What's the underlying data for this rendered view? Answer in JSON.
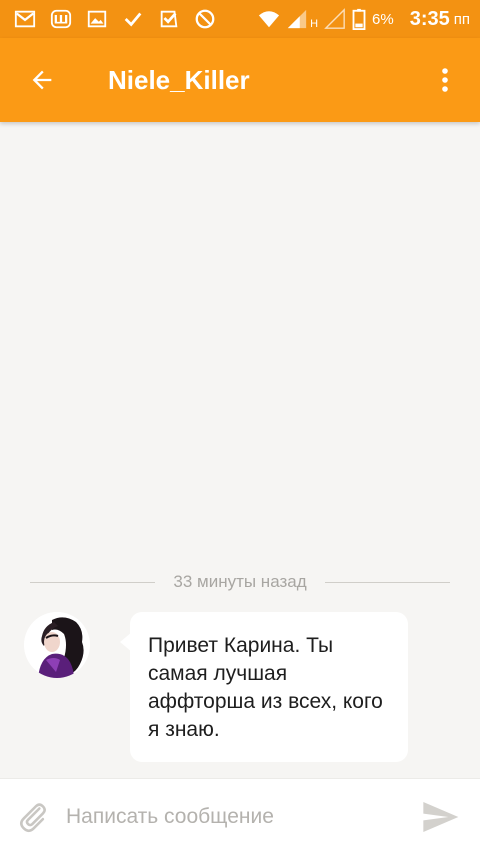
{
  "status_bar": {
    "icons": [
      "gmail-icon",
      "shazam-icon",
      "gallery-icon",
      "check-icon",
      "check-box-icon",
      "do-not-disturb-icon",
      "wifi-icon",
      "signal-icon",
      "signal-empty-icon",
      "battery-icon"
    ],
    "network_label": "H",
    "battery_percent": "6%",
    "time": "3:35",
    "ampm": "пп"
  },
  "app_bar": {
    "title": "Niele_Killer",
    "color": "#fb9a15"
  },
  "chat": {
    "time_divider": "33 минуты назад",
    "messages": [
      {
        "sender_avatar": "avatar",
        "text": "Привет Карина. Ты самая лучшая аффторша из всех, кого я знаю."
      }
    ]
  },
  "composer": {
    "placeholder": "Написать сообщение",
    "value": ""
  },
  "colors": {
    "status_bar": "#f39212",
    "accent": "#fb9a15",
    "background": "#f6f5f3"
  }
}
